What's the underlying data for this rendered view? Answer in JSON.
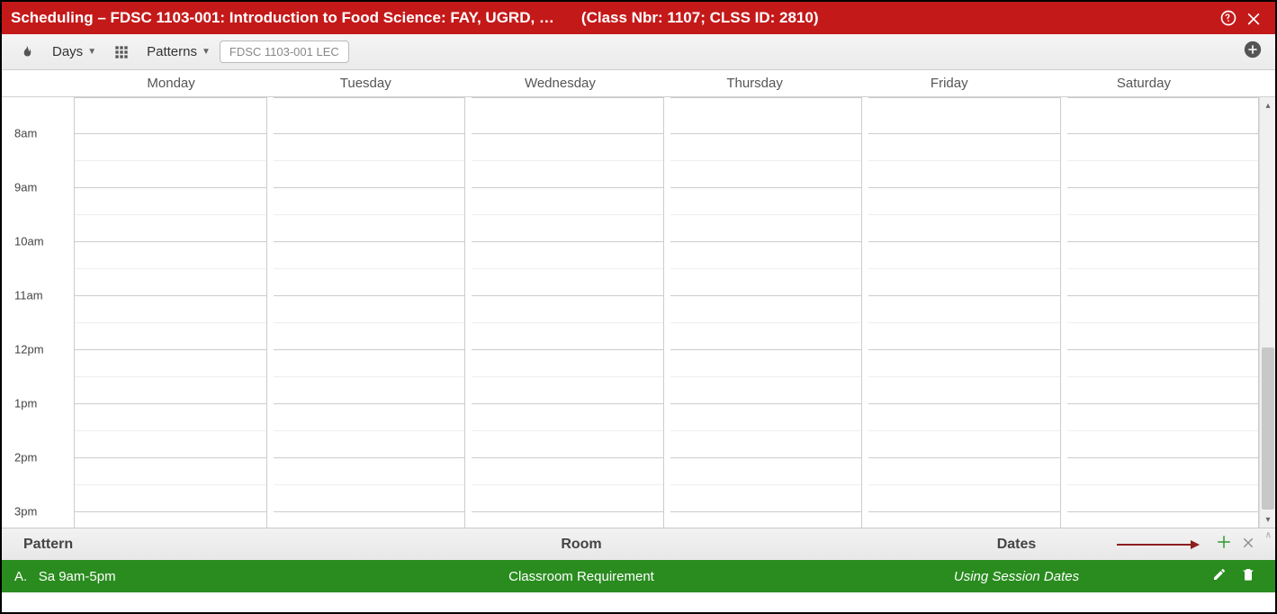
{
  "titlebar": {
    "title": "Scheduling – FDSC 1103-001: Introduction to Food Science: FAY, UGRD, …",
    "subtitle": "(Class Nbr: 1107; CLSS ID: 2810)"
  },
  "toolbar": {
    "days_label": "Days",
    "patterns_label": "Patterns",
    "chip_label": "FDSC 1103-001 LEC"
  },
  "calendar": {
    "days": [
      "Monday",
      "Tuesday",
      "Wednesday",
      "Thursday",
      "Friday",
      "Saturday"
    ],
    "time_labels": [
      "8am",
      "9am",
      "10am",
      "11am",
      "12pm",
      "1pm",
      "2pm",
      "3pm"
    ]
  },
  "footer": {
    "headers": {
      "pattern": "Pattern",
      "room": "Room",
      "dates": "Dates"
    },
    "row": {
      "label": "A.",
      "pattern": "Sa 9am-5pm",
      "room": "Classroom Requirement",
      "dates": "Using Session Dates"
    }
  }
}
